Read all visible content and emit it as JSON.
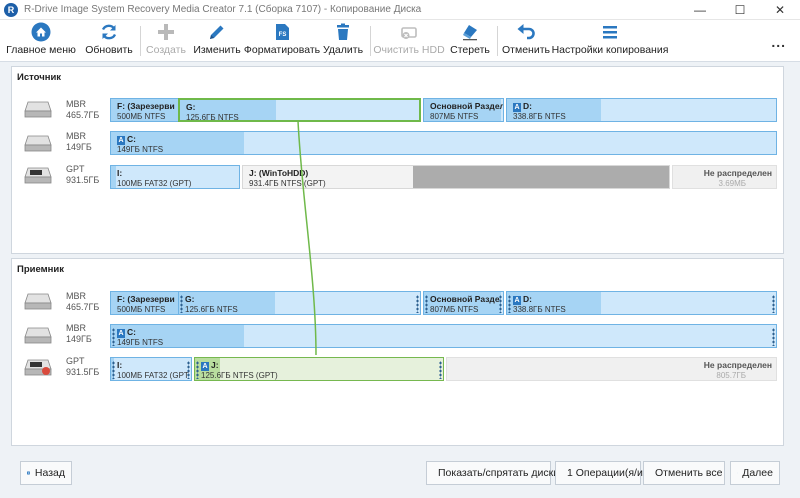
{
  "window": {
    "logo_letter": "R",
    "title": "R-Drive Image System Recovery Media Creator 7.1 (Сборка 7107) - Копирование Диска",
    "minimize": "—",
    "maximize": "☐",
    "close": "✕"
  },
  "toolbar": {
    "home": "Главное меню",
    "refresh": "Обновить",
    "create": "Создать",
    "modify": "Изменить",
    "format": "Форматировать",
    "delete": "Удалить",
    "clear_hdd": "Очистить HDD",
    "erase": "Стереть",
    "cancel": "Отменить",
    "copy_settings": "Настройки копирования",
    "more": "...",
    "format_icon_text": "FS"
  },
  "source": {
    "title": "Источник",
    "disks": [
      {
        "type": "MBR",
        "size": "465.7ГБ",
        "partitions": [
          {
            "name": "F: (Зарезерви",
            "info": "500МБ NTFS"
          },
          {
            "name": "G:",
            "info": "125.6ГБ NTFS"
          },
          {
            "name": "Основной Раздел",
            "info": "807МБ NTFS"
          },
          {
            "name": "D:",
            "info": "338.8ГБ NTFS"
          }
        ]
      },
      {
        "type": "MBR",
        "size": "149ГБ",
        "partitions": [
          {
            "name": "C:",
            "info": "149ГБ NTFS"
          }
        ]
      },
      {
        "type": "GPT",
        "size": "931.5ГБ",
        "partitions": [
          {
            "name": "I:",
            "info": "100МБ FAT32 (GPT)"
          },
          {
            "name": "J: (WinToHDD)",
            "info": "931.4ГБ NTFS (GPT)"
          },
          {
            "name": "Не распределен",
            "info": "3.69МБ"
          }
        ]
      }
    ]
  },
  "target": {
    "title": "Приемник",
    "disks": [
      {
        "type": "MBR",
        "size": "465.7ГБ",
        "partitions": [
          {
            "name": "F: (Зарезерви",
            "info": "500МБ NTFS"
          },
          {
            "name": "G:",
            "info": "125.6ГБ NTFS"
          },
          {
            "name": "Основной Разде",
            "info": "807МБ NTFS"
          },
          {
            "name": "D:",
            "info": "338.8ГБ NTFS"
          }
        ]
      },
      {
        "type": "MBR",
        "size": "149ГБ",
        "partitions": [
          {
            "name": "C:",
            "info": "149ГБ NTFS"
          }
        ]
      },
      {
        "type": "GPT",
        "size": "931.5ГБ",
        "partitions": [
          {
            "name": "I:",
            "info": "100МБ FAT32 (GPT"
          },
          {
            "name": "J:",
            "info": "125.6ГБ NTFS (GPT)"
          },
          {
            "name": "Не распределен",
            "info": "805.7ГБ"
          }
        ]
      }
    ]
  },
  "bottom": {
    "back": "Назад",
    "show_hide": "Показать/спрятать диски",
    "operations": "1 Операции(я/и)",
    "cancel_all": "Отменить все",
    "next": "Далее"
  },
  "colors": {
    "accent": "#2b78c0",
    "partition_fill": "#cfe8fb",
    "partition_used": "#a6d4f4",
    "selection_green": "#6fb94a"
  }
}
